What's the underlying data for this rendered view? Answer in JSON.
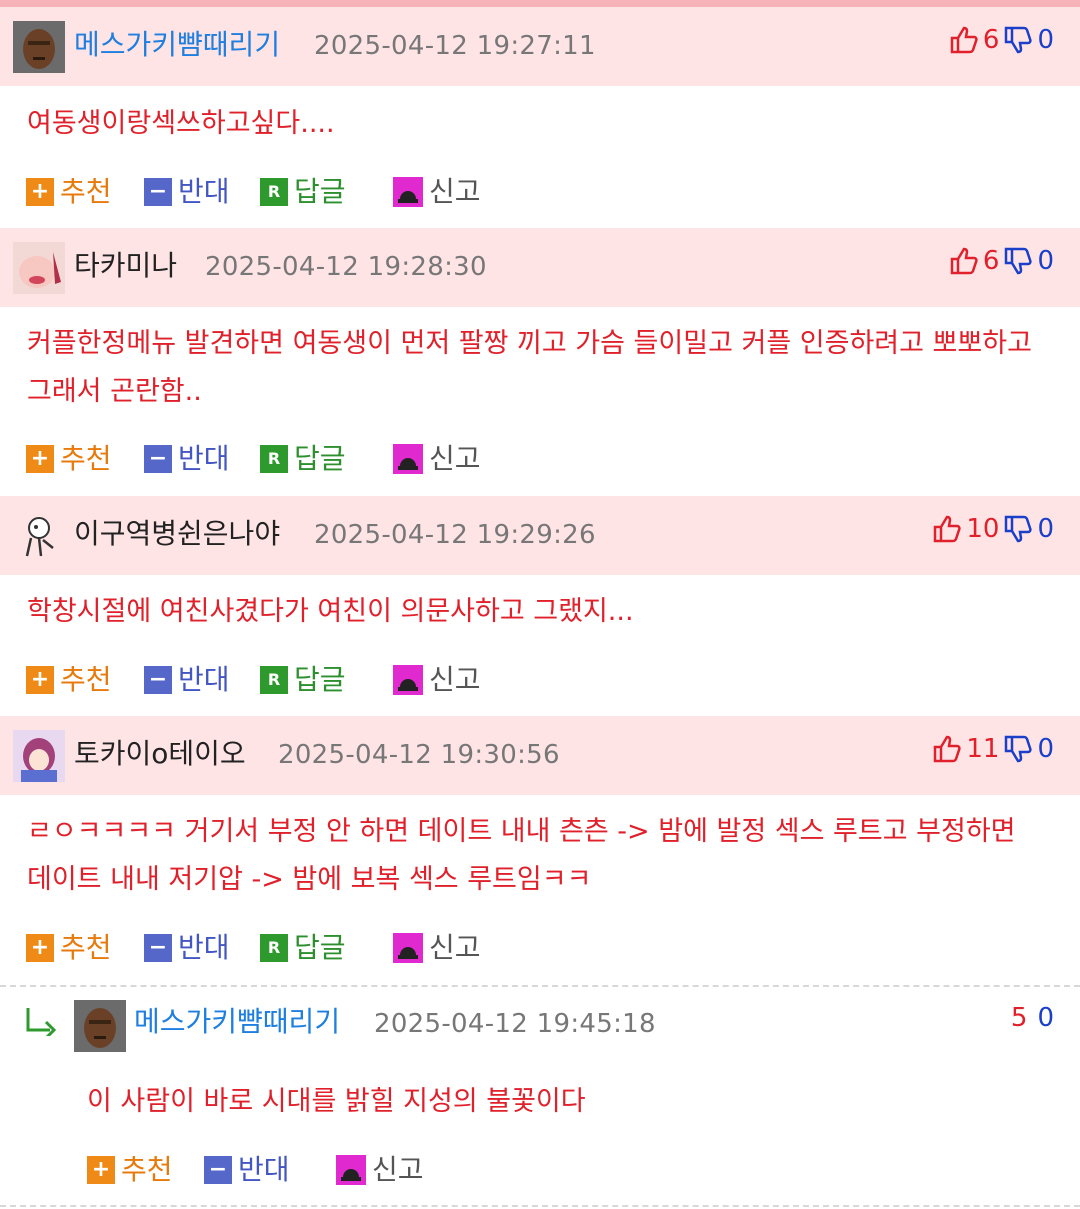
{
  "actions": {
    "recommend": "추천",
    "oppose": "반대",
    "reply": "답글",
    "report": "신고"
  },
  "comments": [
    {
      "nick": "메스가키뺨때리기",
      "date": "2025-04-12 19:27:11",
      "up": "6",
      "down": "0",
      "text": "여동생이랑섹쓰하고싶다...."
    },
    {
      "nick": "타카미나",
      "date": "2025-04-12 19:28:30",
      "up": "6",
      "down": "0",
      "text": "커플한정메뉴 발견하면 여동생이 먼저 팔짱 끼고 가슴 들이밀고 커플 인증하려고 뽀뽀하고 그래서 곤란함.."
    },
    {
      "nick": "이구역병쉰은나야",
      "date": "2025-04-12 19:29:26",
      "up": "10",
      "down": "0",
      "text": "학창시절에 여친사겼다가 여친이 의문사하고 그랬지..."
    },
    {
      "nick": "토카이o테이오",
      "date": "2025-04-12 19:30:56",
      "up": "11",
      "down": "0",
      "text": "ㄹㅇㅋㅋㅋㅋ 거기서 부정 안 하면 데이트 내내 츤츤 -> 밤에 발정 섹스 루트고 부정하면 데이트 내내 저기압 -> 밤에 보복 섹스 루트임ㅋㅋ"
    }
  ],
  "reply": {
    "nick": "메스가키뺨때리기",
    "date": "2025-04-12 19:45:18",
    "up": "5",
    "down": "0",
    "text": "이 사람이 바로 시대를 밝힐 지성의 불꽃이다"
  }
}
